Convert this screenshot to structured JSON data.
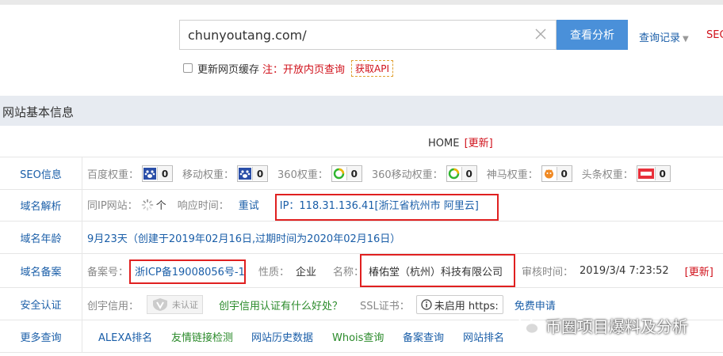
{
  "search": {
    "value": "chunyoutang.com/",
    "button_label": "查看分析",
    "history_label": "查询记录",
    "seo_label": "SEO"
  },
  "options": {
    "refresh_label": "更新网页缓存",
    "note": "注：开放内页查询",
    "api_label": "获取API"
  },
  "section": {
    "title": "网站基本信息",
    "home_label": "HOME",
    "home_update": "[更新]"
  },
  "seo": {
    "label": "SEO信息",
    "items": [
      {
        "name": "百度权重：",
        "value": "0",
        "icon": "baidu-paw-icon"
      },
      {
        "name": "移动权重：",
        "value": "0",
        "icon": "baidu-mobile-paw-icon"
      },
      {
        "name": "360权重：",
        "value": "0",
        "icon": "360-icon"
      },
      {
        "name": "360移动权重：",
        "value": "0",
        "icon": "360-mobile-icon"
      },
      {
        "name": "神马权重：",
        "value": "0",
        "icon": "shenma-icon"
      },
      {
        "name": "头条权重：",
        "value": "0",
        "icon": "toutiao-icon"
      }
    ]
  },
  "dns": {
    "label": "域名解析",
    "same_ip": "同IP网站：",
    "same_ip_value": "个",
    "response": "响应时间：",
    "retry": "重试",
    "ip": "IP：118.31.136.41[浙江省杭州市 阿里云]"
  },
  "age": {
    "label": "域名年龄",
    "value": "9月23天（创建于2019年02月16日,过期时间为2020年02月16日）"
  },
  "icp": {
    "label": "域名备案",
    "num_label": "备案号：",
    "num": "浙ICP备19008056号-1",
    "nature_label": "性质：",
    "nature": "企业",
    "name_label": "名称：",
    "name": "椿佑堂（杭州）科技有限公司",
    "review_label": "审核时间：",
    "review": "2019/3/4 7:23:52",
    "update": "[更新]"
  },
  "security": {
    "label": "安全认证",
    "credit_label": "创宇信用：",
    "cert_text": "未认证",
    "credit_link": "创宇信用认证有什么好处？",
    "ssl_label": "SSL证书：",
    "ssl_status": "未启用 https:",
    "apply": "免费申请"
  },
  "more": {
    "label": "更多查询",
    "links": [
      "ALEXA排名",
      "友情链接检测",
      "网站历史数据",
      "Whois查询",
      "备案查询",
      "网站排名"
    ]
  },
  "watermark": "币圈项目爆料及分析"
}
